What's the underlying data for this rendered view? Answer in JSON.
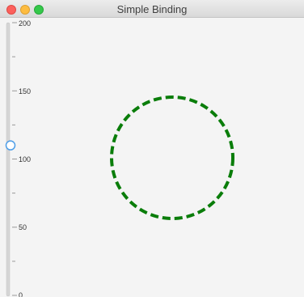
{
  "window": {
    "title": "Simple Binding"
  },
  "slider": {
    "min": 0,
    "max": 200,
    "value": 110,
    "major_ticks": [
      "200",
      "150",
      "100",
      "50",
      "0"
    ],
    "orientation": "vertical"
  },
  "circle": {
    "stroke_color": "#0a7d0a",
    "stroke_style": "dashed",
    "radius_value": 110
  },
  "colors": {
    "slider_thumb": "#4d9ee8",
    "track": "#c9c9c9"
  }
}
